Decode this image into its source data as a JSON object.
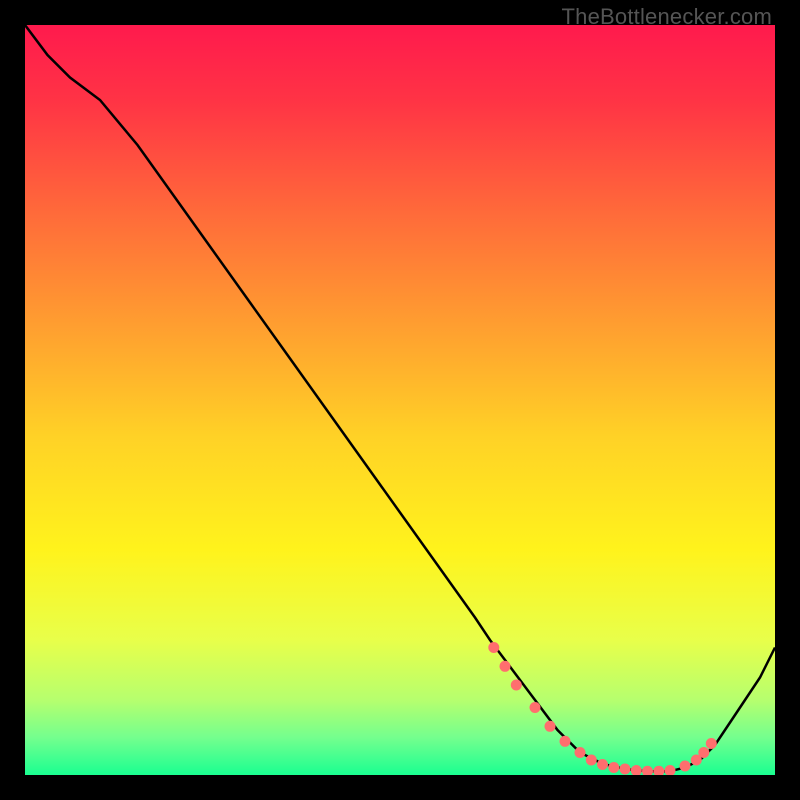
{
  "watermark": "TheBottlenecker.com",
  "chart_data": {
    "type": "line",
    "title": "",
    "xlabel": "",
    "ylabel": "",
    "xlim": [
      0,
      100
    ],
    "ylim": [
      0,
      100
    ],
    "series": [
      {
        "name": "curve",
        "x": [
          0,
          3,
          6,
          10,
          15,
          20,
          25,
          30,
          35,
          40,
          45,
          50,
          55,
          60,
          62,
          65,
          68,
          71,
          74,
          77,
          80,
          83,
          86,
          88,
          90,
          92,
          94,
          96,
          98,
          100
        ],
        "y": [
          100,
          96,
          93,
          90,
          84,
          77,
          70,
          63,
          56,
          49,
          42,
          35,
          28,
          21,
          18,
          14,
          10,
          6,
          3,
          1.5,
          0.8,
          0.5,
          0.5,
          1,
          2,
          4,
          7,
          10,
          13,
          17
        ]
      }
    ],
    "markers": {
      "x": [
        62.5,
        64,
        65.5,
        68,
        70,
        72,
        74,
        75.5,
        77,
        78.5,
        80,
        81.5,
        83,
        84.5,
        86,
        88,
        89.5,
        90.5,
        91.5
      ],
      "y": [
        17,
        14.5,
        12,
        9,
        6.5,
        4.5,
        3,
        2,
        1.4,
        1,
        0.8,
        0.6,
        0.5,
        0.5,
        0.6,
        1.2,
        2,
        3,
        4.2
      ]
    },
    "gradient_stops": [
      {
        "offset": 0.0,
        "color": "#ff1a4d"
      },
      {
        "offset": 0.1,
        "color": "#ff3345"
      },
      {
        "offset": 0.25,
        "color": "#ff6a3a"
      },
      {
        "offset": 0.4,
        "color": "#ff9e30"
      },
      {
        "offset": 0.55,
        "color": "#ffd226"
      },
      {
        "offset": 0.7,
        "color": "#fff31c"
      },
      {
        "offset": 0.82,
        "color": "#e8ff4a"
      },
      {
        "offset": 0.9,
        "color": "#b6ff6e"
      },
      {
        "offset": 0.95,
        "color": "#74ff8e"
      },
      {
        "offset": 1.0,
        "color": "#1aff91"
      }
    ]
  }
}
